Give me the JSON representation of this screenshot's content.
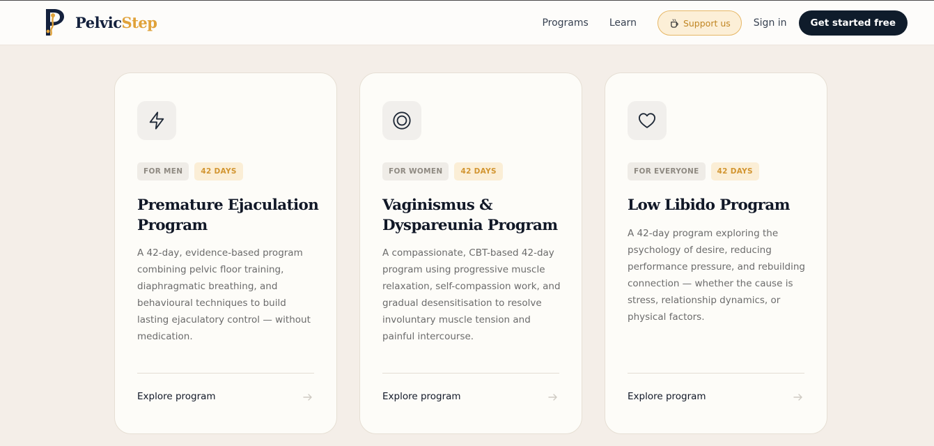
{
  "brand": {
    "part1": "Pelvic",
    "part2": "Step",
    "accent": "#e0a23a",
    "navy": "#14213d"
  },
  "nav": {
    "programs": "Programs",
    "learn": "Learn",
    "support": "Support us",
    "signin": "Sign in",
    "cta": "Get started free"
  },
  "cards": [
    {
      "icon": "lightning-icon",
      "audience": "FOR MEN",
      "days": "42 DAYS",
      "title": "Premature Ejaculation Program",
      "description": "A 42-day, evidence-based program combining pelvic floor training, diaphragmatic breathing, and behavioural techniques to build lasting ejaculatory control — without medication.",
      "link": "Explore program"
    },
    {
      "icon": "target-icon",
      "audience": "FOR WOMEN",
      "days": "42 DAYS",
      "title": "Vaginismus & Dyspareunia Program",
      "description": "A compassionate, CBT-based 42-day program using progressive muscle relaxation, self-compassion work, and gradual desensitisation to resolve involuntary muscle tension and painful intercourse.",
      "link": "Explore program"
    },
    {
      "icon": "heart-icon",
      "audience": "FOR EVERYONE",
      "days": "42 DAYS",
      "title": "Low Libido Program",
      "description": "A 42-day program exploring the psychology of desire, reducing performance pressure, and rebuilding connection — whether the cause is stress, relationship dynamics, or physical factors.",
      "link": "Explore program"
    }
  ]
}
